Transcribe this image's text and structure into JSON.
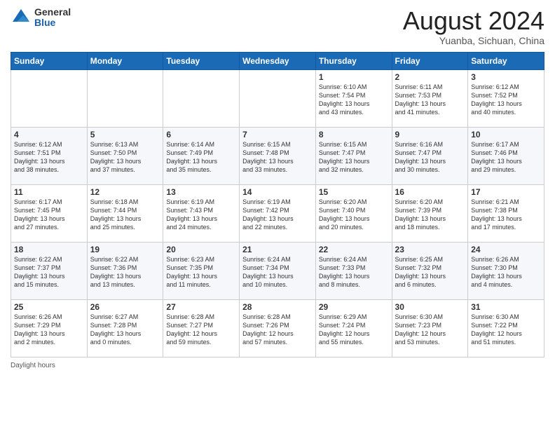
{
  "logo": {
    "general": "General",
    "blue": "Blue"
  },
  "header": {
    "month_year": "August 2024",
    "location": "Yuanba, Sichuan, China"
  },
  "weekdays": [
    "Sunday",
    "Monday",
    "Tuesday",
    "Wednesday",
    "Thursday",
    "Friday",
    "Saturday"
  ],
  "footer": {
    "daylight_label": "Daylight hours"
  },
  "weeks": [
    [
      {
        "day": "",
        "info": ""
      },
      {
        "day": "",
        "info": ""
      },
      {
        "day": "",
        "info": ""
      },
      {
        "day": "",
        "info": ""
      },
      {
        "day": "1",
        "info": "Sunrise: 6:10 AM\nSunset: 7:54 PM\nDaylight: 13 hours\nand 43 minutes."
      },
      {
        "day": "2",
        "info": "Sunrise: 6:11 AM\nSunset: 7:53 PM\nDaylight: 13 hours\nand 41 minutes."
      },
      {
        "day": "3",
        "info": "Sunrise: 6:12 AM\nSunset: 7:52 PM\nDaylight: 13 hours\nand 40 minutes."
      }
    ],
    [
      {
        "day": "4",
        "info": "Sunrise: 6:12 AM\nSunset: 7:51 PM\nDaylight: 13 hours\nand 38 minutes."
      },
      {
        "day": "5",
        "info": "Sunrise: 6:13 AM\nSunset: 7:50 PM\nDaylight: 13 hours\nand 37 minutes."
      },
      {
        "day": "6",
        "info": "Sunrise: 6:14 AM\nSunset: 7:49 PM\nDaylight: 13 hours\nand 35 minutes."
      },
      {
        "day": "7",
        "info": "Sunrise: 6:15 AM\nSunset: 7:48 PM\nDaylight: 13 hours\nand 33 minutes."
      },
      {
        "day": "8",
        "info": "Sunrise: 6:15 AM\nSunset: 7:47 PM\nDaylight: 13 hours\nand 32 minutes."
      },
      {
        "day": "9",
        "info": "Sunrise: 6:16 AM\nSunset: 7:47 PM\nDaylight: 13 hours\nand 30 minutes."
      },
      {
        "day": "10",
        "info": "Sunrise: 6:17 AM\nSunset: 7:46 PM\nDaylight: 13 hours\nand 29 minutes."
      }
    ],
    [
      {
        "day": "11",
        "info": "Sunrise: 6:17 AM\nSunset: 7:45 PM\nDaylight: 13 hours\nand 27 minutes."
      },
      {
        "day": "12",
        "info": "Sunrise: 6:18 AM\nSunset: 7:44 PM\nDaylight: 13 hours\nand 25 minutes."
      },
      {
        "day": "13",
        "info": "Sunrise: 6:19 AM\nSunset: 7:43 PM\nDaylight: 13 hours\nand 24 minutes."
      },
      {
        "day": "14",
        "info": "Sunrise: 6:19 AM\nSunset: 7:42 PM\nDaylight: 13 hours\nand 22 minutes."
      },
      {
        "day": "15",
        "info": "Sunrise: 6:20 AM\nSunset: 7:40 PM\nDaylight: 13 hours\nand 20 minutes."
      },
      {
        "day": "16",
        "info": "Sunrise: 6:20 AM\nSunset: 7:39 PM\nDaylight: 13 hours\nand 18 minutes."
      },
      {
        "day": "17",
        "info": "Sunrise: 6:21 AM\nSunset: 7:38 PM\nDaylight: 13 hours\nand 17 minutes."
      }
    ],
    [
      {
        "day": "18",
        "info": "Sunrise: 6:22 AM\nSunset: 7:37 PM\nDaylight: 13 hours\nand 15 minutes."
      },
      {
        "day": "19",
        "info": "Sunrise: 6:22 AM\nSunset: 7:36 PM\nDaylight: 13 hours\nand 13 minutes."
      },
      {
        "day": "20",
        "info": "Sunrise: 6:23 AM\nSunset: 7:35 PM\nDaylight: 13 hours\nand 11 minutes."
      },
      {
        "day": "21",
        "info": "Sunrise: 6:24 AM\nSunset: 7:34 PM\nDaylight: 13 hours\nand 10 minutes."
      },
      {
        "day": "22",
        "info": "Sunrise: 6:24 AM\nSunset: 7:33 PM\nDaylight: 13 hours\nand 8 minutes."
      },
      {
        "day": "23",
        "info": "Sunrise: 6:25 AM\nSunset: 7:32 PM\nDaylight: 13 hours\nand 6 minutes."
      },
      {
        "day": "24",
        "info": "Sunrise: 6:26 AM\nSunset: 7:30 PM\nDaylight: 13 hours\nand 4 minutes."
      }
    ],
    [
      {
        "day": "25",
        "info": "Sunrise: 6:26 AM\nSunset: 7:29 PM\nDaylight: 13 hours\nand 2 minutes."
      },
      {
        "day": "26",
        "info": "Sunrise: 6:27 AM\nSunset: 7:28 PM\nDaylight: 13 hours\nand 0 minutes."
      },
      {
        "day": "27",
        "info": "Sunrise: 6:28 AM\nSunset: 7:27 PM\nDaylight: 12 hours\nand 59 minutes."
      },
      {
        "day": "28",
        "info": "Sunrise: 6:28 AM\nSunset: 7:26 PM\nDaylight: 12 hours\nand 57 minutes."
      },
      {
        "day": "29",
        "info": "Sunrise: 6:29 AM\nSunset: 7:24 PM\nDaylight: 12 hours\nand 55 minutes."
      },
      {
        "day": "30",
        "info": "Sunrise: 6:30 AM\nSunset: 7:23 PM\nDaylight: 12 hours\nand 53 minutes."
      },
      {
        "day": "31",
        "info": "Sunrise: 6:30 AM\nSunset: 7:22 PM\nDaylight: 12 hours\nand 51 minutes."
      }
    ]
  ]
}
